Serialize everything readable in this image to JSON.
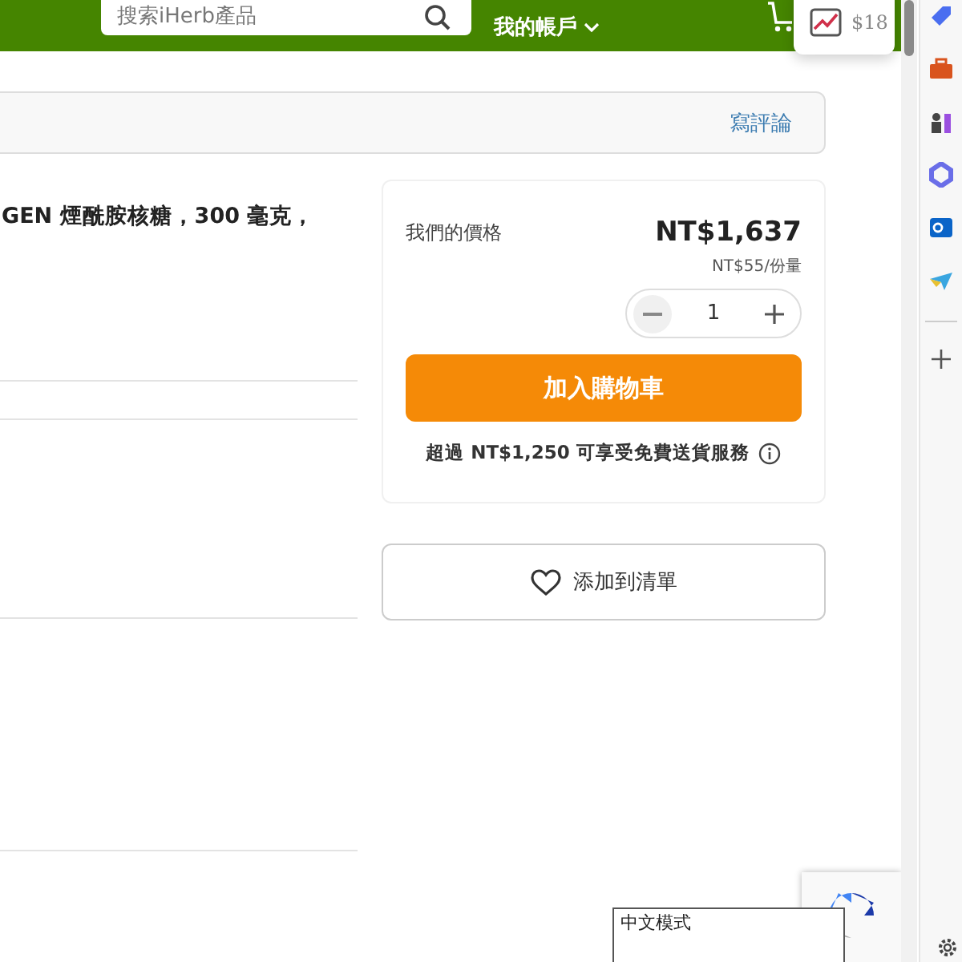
{
  "header": {
    "search": {
      "placeholder": "搜索iHerb產品"
    },
    "account_menu": "我的帳戶"
  },
  "rewards_popup": {
    "amount": "$18"
  },
  "review_bar": {
    "link": "寫評論"
  },
  "product": {
    "title": "GEN 煙酰胺核糖，300 毫克，"
  },
  "buy_box": {
    "price_label": "我們的價格",
    "price": "NT$1,637",
    "unit_price": "NT$55/份量",
    "quantity": "1",
    "add_to_cart": "加入購物車",
    "shipping_note": "超過 NT$1,250 可享受免費送貨服務"
  },
  "wishlist_button": "添加到清單",
  "ime_tooltip": "中文模式"
}
